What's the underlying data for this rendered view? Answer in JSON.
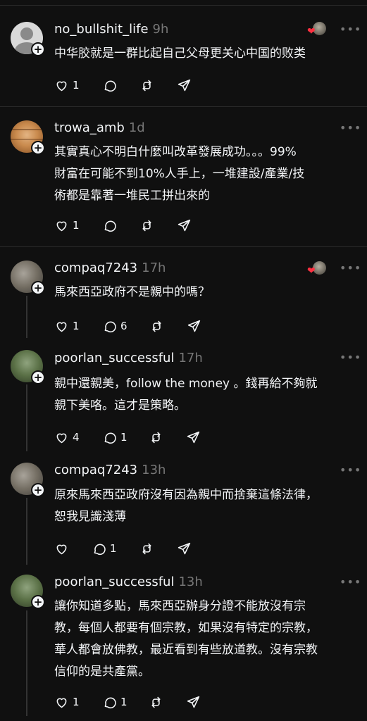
{
  "posts": [
    {
      "username": "no_bullshit_life",
      "time": "9h",
      "text": "中华胶就是一群比起自己父母更关心中国的败类",
      "likes": "1",
      "replies": "",
      "avatar": "default-avatar",
      "liked_by": true
    },
    {
      "username": "trowa_amb",
      "time": "1d",
      "text": "其實真心不明白什麼叫改革發展成功。。。99%\n財富在可能不到10%人手上，一堆建設/產業/技\n術都是靠著一堆民工拼出來的",
      "likes": "1",
      "replies": "",
      "avatar": "wood-avatar",
      "liked_by": false
    },
    {
      "username": "compaq7243",
      "time": "17h",
      "text": "馬來西亞政府不是親中的嗎？",
      "likes": "1",
      "replies": "6",
      "avatar": "photo-avatar",
      "liked_by": true
    },
    {
      "username": "poorlan_successful",
      "time": "17h",
      "text": "親中還親美，follow the money 。錢再給不夠就\n親下美咯。這才是策略。",
      "likes": "4",
      "replies": "1",
      "avatar": "photo-avatar",
      "liked_by": false
    },
    {
      "username": "compaq7243",
      "time": "13h",
      "text": "原來馬來西亞政府沒有因為親中而捨棄這條法律，\n恕我見識淺薄",
      "likes": "",
      "replies": "1",
      "avatar": "photo-avatar",
      "liked_by": false
    },
    {
      "username": "poorlan_successful",
      "time": "13h",
      "text": "讓你知道多點，馬來西亞辦身分證不能放沒有宗\n教，每個人都要有個宗教，如果沒有特定的宗教，\n華人都會放佛教，最近看到有些放道教。沒有宗教\n信仰的是共產黨。",
      "likes": "1",
      "replies": "1",
      "avatar": "photo-avatar",
      "liked_by": false
    }
  ],
  "icons": {
    "like": "heart-icon",
    "reply": "comment-icon",
    "repost": "repost-icon",
    "share": "send-icon",
    "more": "more-icon",
    "follow": "plus-icon"
  },
  "colors": {
    "background": "#101010",
    "text": "#f3f5f7",
    "muted": "#777777",
    "heart": "#ff3040"
  },
  "more_label": "•••"
}
